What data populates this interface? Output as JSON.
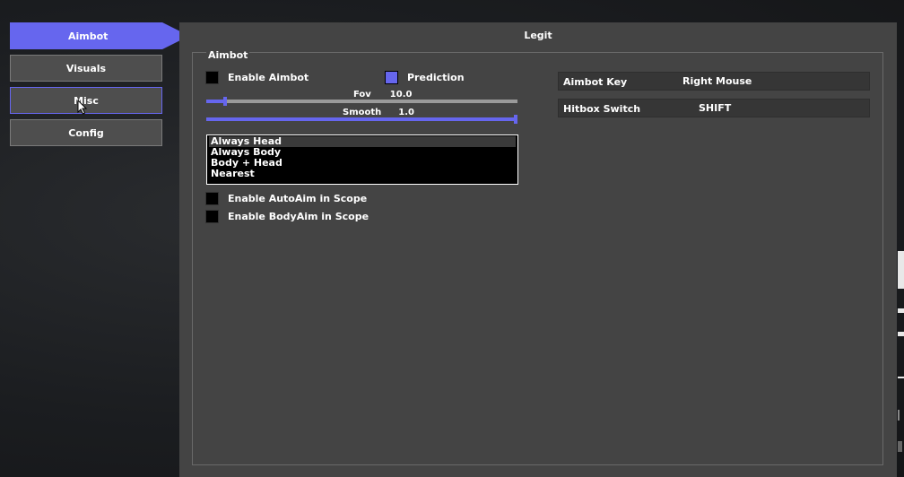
{
  "nav": {
    "items": [
      {
        "label": "Aimbot"
      },
      {
        "label": "Visuals"
      },
      {
        "label": "Misc"
      },
      {
        "label": "Config"
      }
    ]
  },
  "window": {
    "title": "Legit",
    "group_label": "Aimbot"
  },
  "aimbot": {
    "enable_label": "Enable Aimbot",
    "enable_checked": false,
    "prediction_label": "Prediction",
    "prediction_checked": true,
    "fov_label": "Fov",
    "fov_value": "10.0",
    "fov_fraction": 0.06,
    "smooth_label": "Smooth",
    "smooth_value": "1.0",
    "smooth_fraction": 1.0,
    "hitbox_options": [
      "Always Head",
      "Always Body",
      "Body + Head",
      "Nearest"
    ],
    "hitbox_selected": "Always Head",
    "autoaim_scope_label": "Enable AutoAim in Scope",
    "bodyaim_scope_label": "Enable BodyAim in Scope"
  },
  "keybinds": {
    "aimbot_key_label": "Aimbot Key",
    "aimbot_key_value": "Right Mouse",
    "hitbox_switch_label": "Hitbox Switch",
    "hitbox_switch_value": "SHIFT"
  },
  "colors": {
    "accent": "#6666ee",
    "panel": "#444444",
    "button": "#4e4e4e"
  }
}
